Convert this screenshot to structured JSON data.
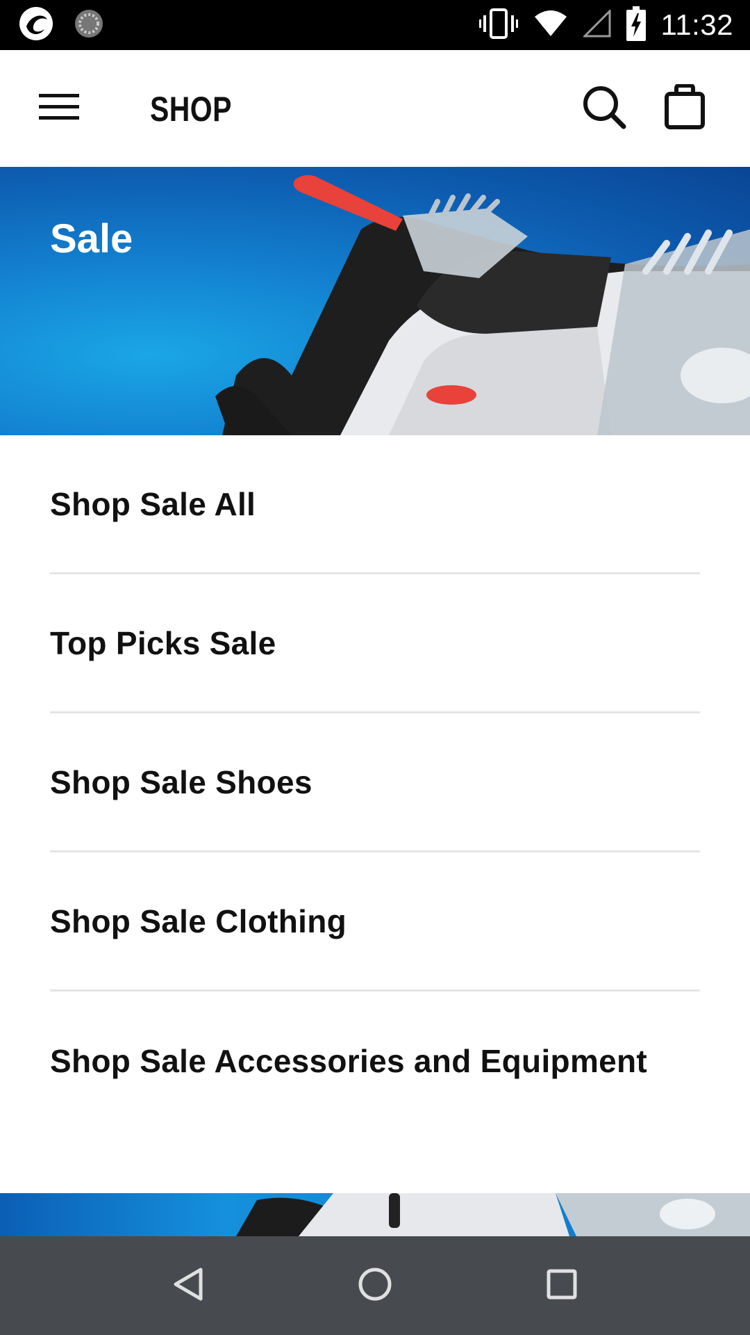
{
  "status_bar": {
    "time": "11:32",
    "icons": [
      "app-notification-icon",
      "sync-icon",
      "vibrate-icon",
      "wifi-icon",
      "signal-icon",
      "battery-charging-icon"
    ]
  },
  "app_bar": {
    "title": "SHOP",
    "menu_icon": "hamburger-menu-icon",
    "search_icon": "search-icon",
    "bag_icon": "shopping-bag-icon"
  },
  "hero": {
    "title": "Sale"
  },
  "menu": {
    "items": [
      {
        "label": "Shop Sale All"
      },
      {
        "label": "Top Picks Sale"
      },
      {
        "label": "Shop Sale Shoes"
      },
      {
        "label": "Shop Sale Clothing"
      },
      {
        "label": "Shop Sale Accessories and Equipment"
      }
    ]
  },
  "nav_bar": {
    "icons": [
      "back-icon",
      "home-icon",
      "recents-icon"
    ]
  },
  "colors": {
    "status_bar_bg": "#000000",
    "app_bar_bg": "#ffffff",
    "hero_blue": "#1380cf",
    "text_primary": "#111111",
    "divider": "#e5e5e5",
    "nav_bar_bg": "#474b4f"
  }
}
